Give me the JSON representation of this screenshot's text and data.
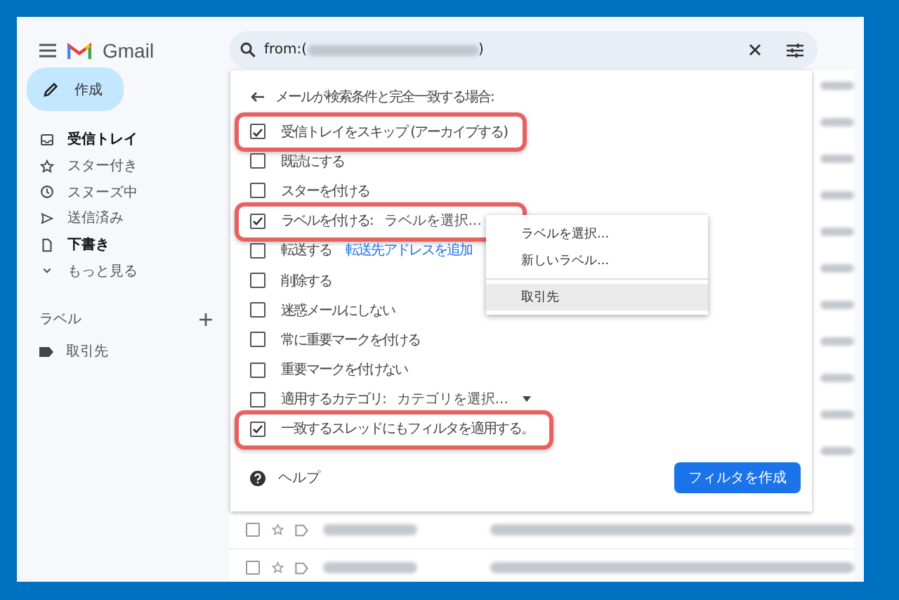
{
  "header": {
    "app_name": "Gmail",
    "search": {
      "query_start": "from:(",
      "query_end": ")"
    }
  },
  "sidebar": {
    "compose": "作成",
    "items": [
      {
        "label": "受信トレイ",
        "bold": true
      },
      {
        "label": "スター付き",
        "bold": false
      },
      {
        "label": "スヌーズ中",
        "bold": false
      },
      {
        "label": "送信済み",
        "bold": false
      },
      {
        "label": "下書き",
        "bold": true
      },
      {
        "label": "もっと見る",
        "bold": false
      }
    ],
    "labels_heading": "ラベル",
    "labels": [
      {
        "name": "取引先"
      }
    ]
  },
  "filter_dialog": {
    "heading": "メールが検索条件と完全一致する場合:",
    "options": [
      {
        "kind": "plain",
        "label": "受信トレイをスキップ (アーカイブする)",
        "checked": true,
        "highlighted": true
      },
      {
        "kind": "plain",
        "label": "既読にする",
        "checked": false,
        "highlighted": false
      },
      {
        "kind": "plain",
        "label": "スターを付ける",
        "checked": false,
        "highlighted": false
      },
      {
        "kind": "select",
        "label": "ラベルを付ける:",
        "value": "ラベルを選択...",
        "checked": true,
        "highlighted": true
      },
      {
        "kind": "link",
        "label": "転送する",
        "link": "転送先アドレスを追加",
        "checked": false,
        "highlighted": false
      },
      {
        "kind": "plain",
        "label": "削除する",
        "checked": false,
        "highlighted": false
      },
      {
        "kind": "plain",
        "label": "迷惑メールにしない",
        "checked": false,
        "highlighted": false
      },
      {
        "kind": "plain",
        "label": "常に重要マークを付ける",
        "checked": false,
        "highlighted": false
      },
      {
        "kind": "plain",
        "label": "重要マークを付けない",
        "checked": false,
        "highlighted": false
      },
      {
        "kind": "select",
        "label": "適用するカテゴリ:",
        "value": "カテゴリを選択...",
        "checked": false,
        "highlighted": false
      },
      {
        "kind": "plain",
        "label": "一致するスレッドにもフィルタを適用する。",
        "checked": true,
        "highlighted": true
      }
    ],
    "help": "ヘルプ",
    "create_button": "フィルタを作成"
  },
  "email_rows": [
    {
      "checked": false
    },
    {
      "checked": false
    }
  ],
  "label_menu": {
    "items": [
      {
        "label": "ラベルを選択...",
        "selected": false
      },
      {
        "label": "新しいラベル...",
        "selected": false
      },
      {
        "label": "取引先",
        "selected": true
      }
    ]
  }
}
